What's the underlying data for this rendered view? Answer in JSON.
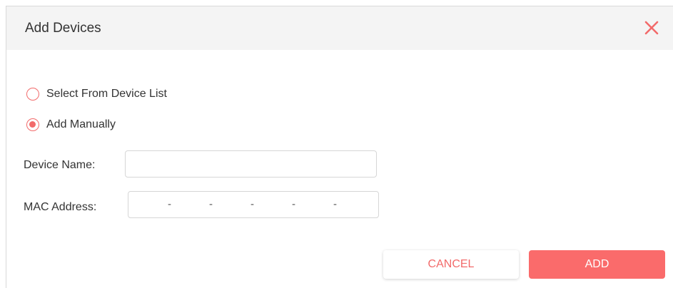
{
  "dialog": {
    "title": "Add Devices",
    "close_icon": "close-icon"
  },
  "options": {
    "select_from_list": {
      "label": "Select From Device List",
      "checked": false
    },
    "add_manually": {
      "label": "Add Manually",
      "checked": true
    }
  },
  "form": {
    "device_name_label": "Device Name:",
    "device_name_value": "",
    "mac_label": "MAC Address:",
    "mac_segments": [
      "",
      "",
      "",
      "",
      "",
      ""
    ],
    "mac_separator": "-"
  },
  "buttons": {
    "cancel": "CANCEL",
    "add": "ADD"
  },
  "colors": {
    "accent": "#fa6b6b",
    "header_bg": "#f4f4f4",
    "text": "#333333"
  }
}
